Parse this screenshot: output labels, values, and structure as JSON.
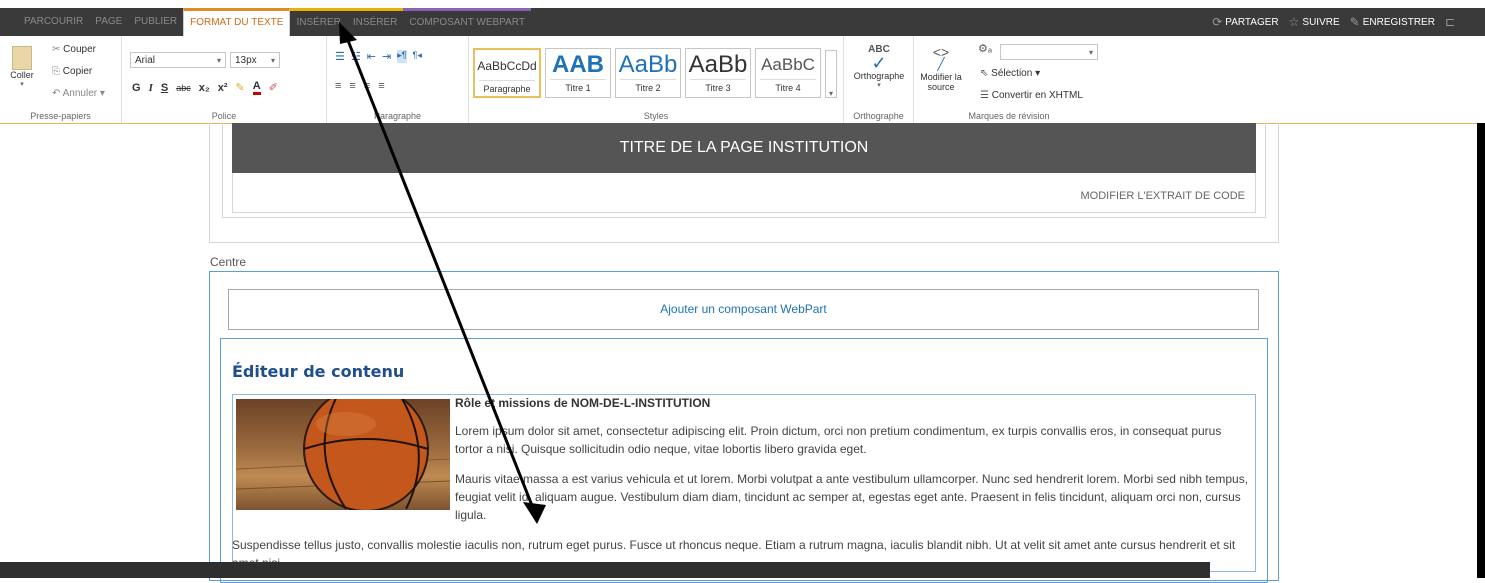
{
  "tabs": [
    {
      "label": "PARCOURIR",
      "state": "normal"
    },
    {
      "label": "PAGE",
      "state": "normal"
    },
    {
      "label": "PUBLIER",
      "state": "normal"
    },
    {
      "label": "FORMAT DU TEXTE",
      "state": "active"
    },
    {
      "label": "INSÉRER",
      "state": "ins1"
    },
    {
      "label": "INSÉRER",
      "state": "ins2"
    },
    {
      "label": "COMPOSANT WEBPART",
      "state": "cwp"
    }
  ],
  "topright": {
    "share": "PARTAGER",
    "follow": "SUIVRE",
    "save": "ENREGISTRER"
  },
  "ribbon": {
    "clipboard": {
      "paste": "Coller",
      "cut": "Couper",
      "copy": "Copier",
      "undo": "Annuler",
      "label": "Presse-papiers"
    },
    "font": {
      "family": "Arial",
      "size": "13px",
      "bold": "G",
      "italic": "I",
      "underline": "S",
      "strike": "abc",
      "sub": "x₂",
      "sup": "x²",
      "label": "Police",
      "color_letter": "A"
    },
    "paragraph": {
      "label": "Paragraphe"
    },
    "styles": {
      "items": [
        {
          "preview": "AaBbCcDd",
          "name": "Paragraphe"
        },
        {
          "preview": "AAB",
          "name": "Titre 1"
        },
        {
          "preview": "AaBb",
          "name": "Titre 2"
        },
        {
          "preview": "AaBb",
          "name": "Titre 3"
        },
        {
          "preview": "AaBbC",
          "name": "Titre 4"
        }
      ],
      "label": "Styles"
    },
    "spelling": {
      "abc": "ABC",
      "button": "Orthographe",
      "label": "Orthographe"
    },
    "markup": {
      "edit_source_1": "Modifier la",
      "edit_source_2": "source",
      "selection": "Sélection",
      "convert": "Convertir en XHTML",
      "label": "Marques de révision"
    }
  },
  "page": {
    "title": "TITRE DE LA PAGE INSTITUTION",
    "edit_snippet": "MODIFIER L'EXTRAIT DE CODE",
    "zone_label": "Centre",
    "add_webpart": "Ajouter un composant WebPart",
    "editor_title": "Éditeur de contenu",
    "article_heading": "Rôle et missions de NOM-DE-L-INSTITUTION",
    "para1": "Lorem ipsum dolor sit amet, consectetur adipiscing elit. Proin dictum, orci non pretium condimentum, ex turpis convallis eros, in consequat purus tortor a nisi. Quisque sollicitudin odio neque, vitae lobortis libero gravida eget.",
    "para2": "Mauris vitae massa a est varius vehicula et ut lorem. Morbi volutpat a ante vestibulum ullamcorper. Nunc sed hendrerit lorem. Morbi sed nibh tempus, feugiat velit id, aliquam augue. Vestibulum diam diam, tincidunt ac semper at, egestas eget ante. Praesent in felis tincidunt, aliquam orci non, cursus ligula.",
    "para3": "Suspendisse tellus justo, convallis molestie iaculis non, rutrum eget purus. Fusce ut rhoncus neque. Etiam a rutrum magna, iaculis blandit nibh. Ut at velit sit amet ante cursus hendrerit et sit amet nisi."
  },
  "colors": {
    "topbar": "#3a3a3a",
    "active_tab": "#d06b17",
    "insert_tab": "#e9b200",
    "webpart_tab": "#8a62b8",
    "title_bar": "#555555",
    "link_blue": "#1f72b8"
  }
}
